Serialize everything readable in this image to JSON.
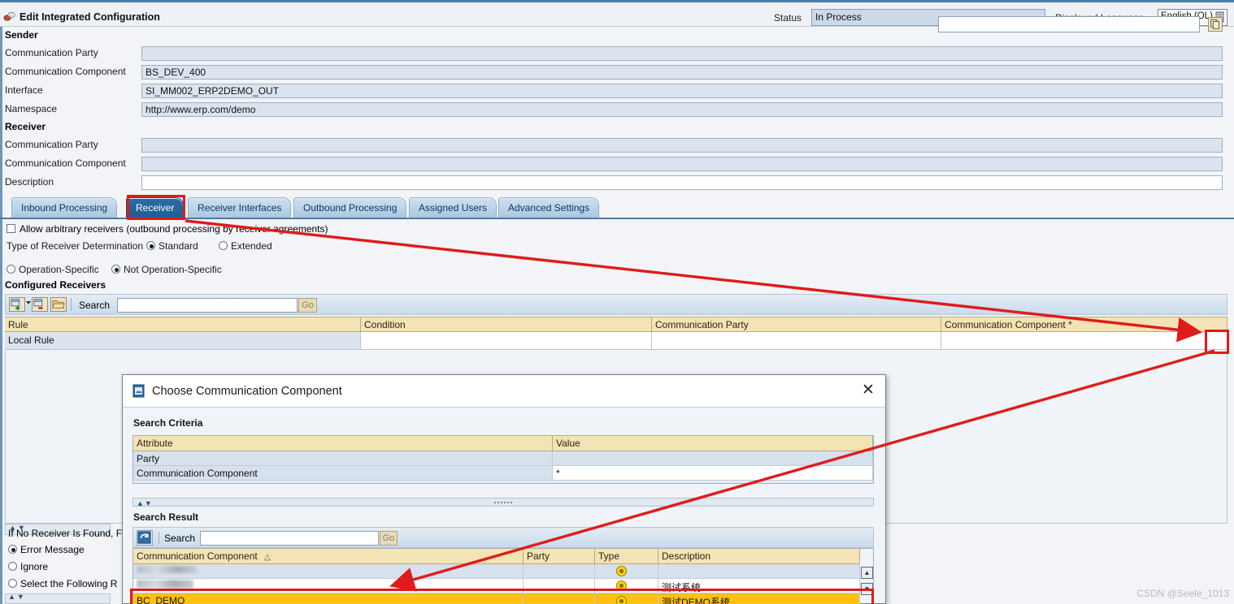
{
  "header": {
    "app_icon": "integrated-configuration-icon",
    "title": "Edit Integrated Configuration",
    "status_label": "Status",
    "status_value": "In Process",
    "language_label": "Displayed Language",
    "language_value": "English (OL)"
  },
  "sender": {
    "section_title": "Sender",
    "fields": [
      {
        "label": "Communication Party",
        "value": ""
      },
      {
        "label": "Communication Component",
        "value": "BS_DEV_400"
      },
      {
        "label": "Interface",
        "value": "SI_MM002_ERP2DEMO_OUT"
      },
      {
        "label": "Namespace",
        "value": "http://www.erp.com/demo"
      }
    ]
  },
  "receiver": {
    "section_title": "Receiver",
    "fields": [
      {
        "label": "Communication Party",
        "value": ""
      },
      {
        "label": "Communication Component",
        "value": ""
      },
      {
        "label": "Description",
        "value": ""
      }
    ]
  },
  "tabs": [
    {
      "label": "Inbound Processing",
      "selected": false
    },
    {
      "label": "Receiver",
      "selected": true
    },
    {
      "label": "Receiver Interfaces",
      "selected": false
    },
    {
      "label": "Outbound Processing",
      "selected": false
    },
    {
      "label": "Assigned Users",
      "selected": false
    },
    {
      "label": "Advanced Settings",
      "selected": false
    }
  ],
  "receiver_tab": {
    "allow_arbitrary_label": "Allow arbitrary receivers (outbound processing by receiver agreements)",
    "allow_arbitrary_checked": false,
    "determination_label": "Type of Receiver Determination",
    "determination_options": [
      {
        "label": "Standard",
        "selected": true
      },
      {
        "label": "Extended",
        "selected": false
      }
    ],
    "operation_options": [
      {
        "label": "Operation-Specific",
        "selected": false
      },
      {
        "label": "Not Operation-Specific",
        "selected": true
      }
    ],
    "configured_receivers_title": "Configured Receivers",
    "toolbar": {
      "insert_row_icon": "insert-row-icon",
      "insert_row_dropdown_icon": "chevron-down-icon",
      "delete_row_icon": "delete-row-icon",
      "open_icon": "open-folder-icon",
      "search_label": "Search",
      "search_value": "",
      "go_label": "Go"
    },
    "grid": {
      "columns": [
        "Rule",
        "Condition",
        "Communication Party",
        "Communication Component *"
      ],
      "rows": [
        {
          "rule": "Local Rule",
          "condition": "",
          "party": "",
          "component": ""
        }
      ],
      "value_help_icon": "value-help-icon"
    },
    "no_receiver_found": {
      "label": "If No Receiver Is Found, F",
      "options": [
        {
          "label": "Error Message",
          "selected": true
        },
        {
          "label": "Ignore",
          "selected": false
        },
        {
          "label": "Select the Following R",
          "selected": false
        }
      ]
    }
  },
  "dialog": {
    "icon": "dialog-window-icon",
    "title": "Choose Communication Component",
    "close_icon": "close-icon",
    "search_criteria": {
      "title": "Search Criteria",
      "columns": [
        "Attribute",
        "Value"
      ],
      "rows": [
        {
          "attribute": "Party",
          "value": ""
        },
        {
          "attribute": "Communication Component",
          "value": "*"
        }
      ]
    },
    "search_result": {
      "title": "Search Result",
      "refresh_icon": "refresh-icon",
      "search_label": "Search",
      "search_value": "",
      "go_label": "Go",
      "columns": [
        "Communication Component",
        "Party",
        "Type",
        "Description"
      ],
      "sort_icon": "sort-ascending-icon",
      "rows": [
        {
          "component": "",
          "party": "",
          "type_icon": "business-system-icon",
          "description": "",
          "redacted": true,
          "selected": false
        },
        {
          "component": "",
          "party": "",
          "type_icon": "business-system-icon",
          "description": "测试系统",
          "redacted": true,
          "selected": false
        },
        {
          "component": "BC_DEMO",
          "party": "",
          "type_icon": "business-system-icon",
          "description": "测试DEMO系统",
          "redacted": false,
          "selected": true
        }
      ],
      "scroll_up_icon": "scroll-up-icon",
      "scroll_down_icon": "scroll-down-icon"
    }
  },
  "annotations": {
    "accent_color": "#e01b1b",
    "highlight_boxes": [
      "receiver-tab",
      "value-help-button",
      "selected-result-row"
    ],
    "arrows": 2
  },
  "watermark": "CSDN @Seele_1013"
}
